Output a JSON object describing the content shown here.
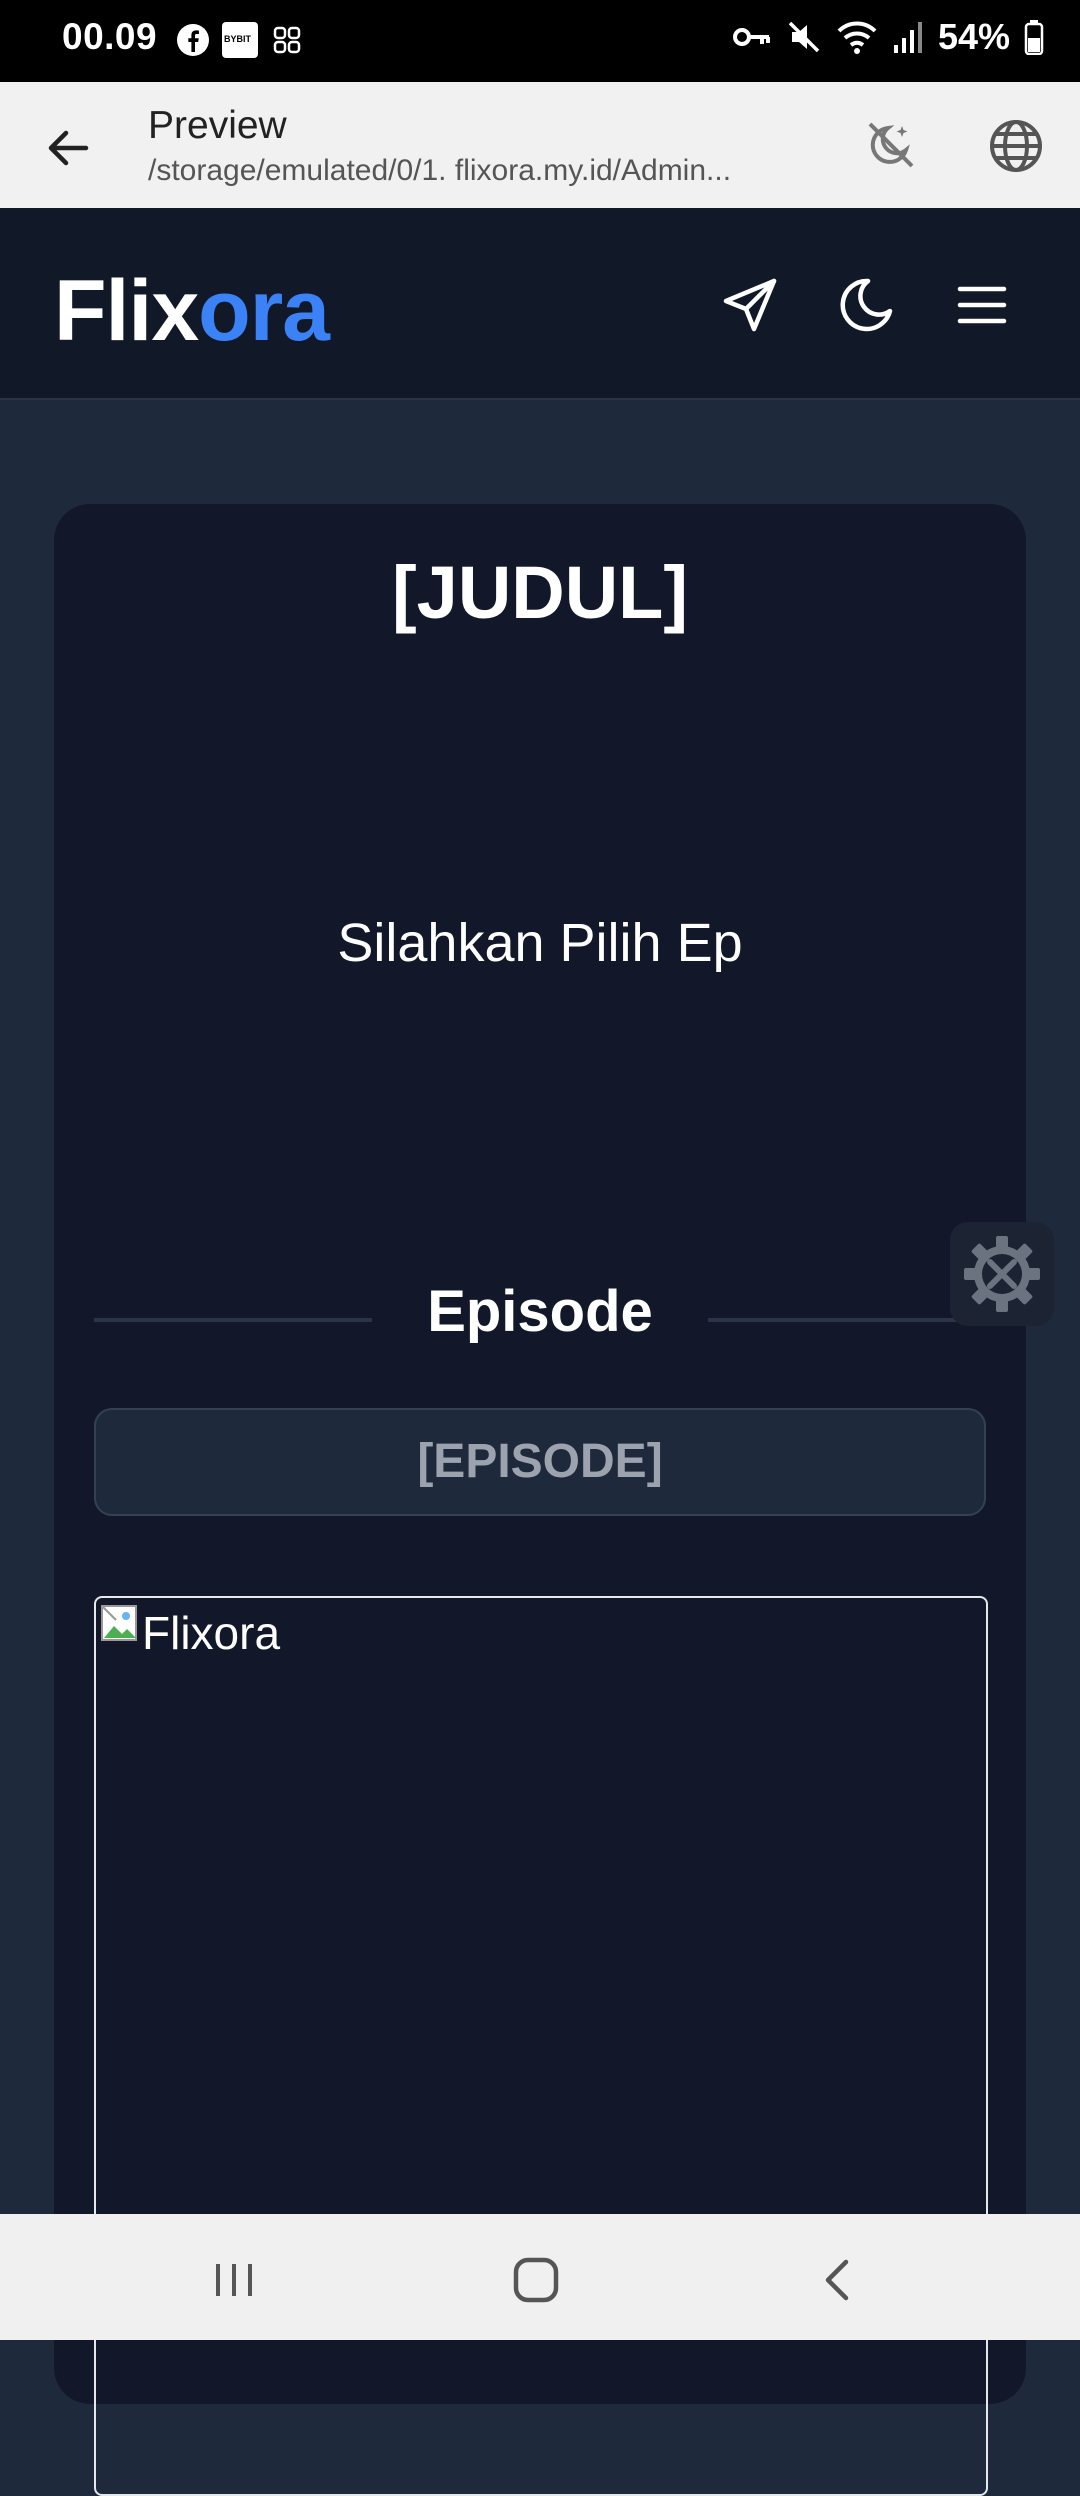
{
  "status_bar": {
    "time": "00.09",
    "app_icons": [
      "facebook-icon",
      "bybit-icon",
      "grid-app-icon"
    ],
    "bybit_text": "BYBIT",
    "right_icons": [
      "vpn-key-icon",
      "mute-icon",
      "wifi-icon",
      "signal-icon",
      "battery-icon"
    ],
    "battery": "54%"
  },
  "app_bar": {
    "title": "Preview",
    "path": "/storage/emulated/0/1. flixora.my.id/Admin..."
  },
  "site_header": {
    "logo_part1": "Flix",
    "logo_part2": "ora",
    "icons": [
      "send-icon",
      "moon-icon",
      "menu-icon"
    ]
  },
  "content": {
    "title": "[JUDUL]",
    "player_message": "Silahkan Pilih Ep",
    "episode_heading": "Episode",
    "episode_button": "[EPISODE]",
    "poster_alt": "Flixora"
  },
  "colors": {
    "accent": "#3b82f6",
    "page_bg": "#1e293b",
    "card_bg": "#121829",
    "header_bg": "#111827"
  }
}
